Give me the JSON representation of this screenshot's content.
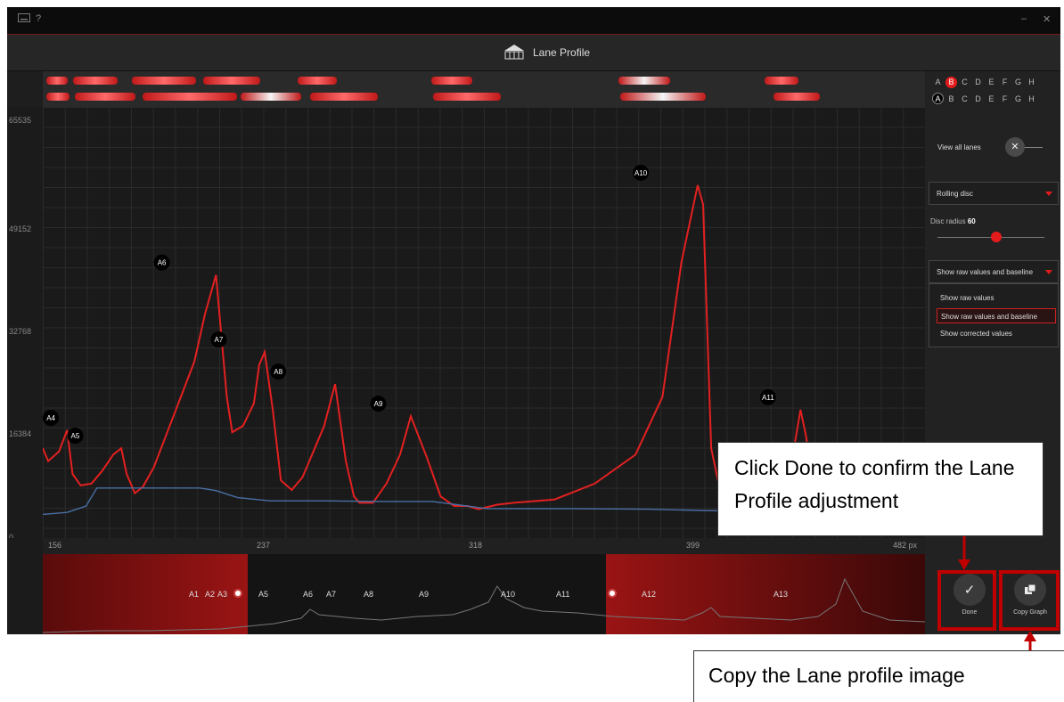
{
  "window": {
    "keyboard_icon": "keyboard-icon",
    "help_label": "?",
    "minimize_label": "–",
    "close_label": "✕"
  },
  "header": {
    "title": "Lane Profile",
    "icon": "gel-box-icon"
  },
  "y_axis": {
    "ticks": [
      "65535",
      "49152",
      "32768",
      "16384",
      "0"
    ]
  },
  "x_axis": {
    "ticks": [
      "156",
      "237",
      "318",
      "399",
      "482 px"
    ]
  },
  "lanes": {
    "top_row": [
      "A",
      "B",
      "C",
      "D",
      "E",
      "F",
      "G",
      "H"
    ],
    "bottom_row": [
      "A",
      "B",
      "C",
      "D",
      "E",
      "F",
      "G",
      "H"
    ],
    "top_selected": "B",
    "bottom_selected": "A"
  },
  "sidebar": {
    "view_all_label": "View all lanes",
    "method_value": "Rolling disc",
    "disc_radius_label": "Disc radius",
    "disc_radius_value": "60",
    "disc_radius_level": 0.55,
    "display_value": "Show raw values and baseline",
    "display_options": [
      "Show raw values",
      "Show raw values and baseline",
      "Show corrected values"
    ],
    "selected_option_index": 1,
    "done_label": "Done",
    "copy_label": "Copy Graph"
  },
  "peaks": [
    "A4",
    "A5",
    "A6",
    "A7",
    "A8",
    "A9",
    "A10",
    "A11"
  ],
  "overview_labels": [
    "A1",
    "A2",
    "A3",
    "A5",
    "A6",
    "A7",
    "A8",
    "A9",
    "A10",
    "A11",
    "A12",
    "A13"
  ],
  "callouts": {
    "done": "Click Done to confirm the Lane Profile adjustment",
    "copy": "Copy the Lane profile image"
  },
  "colors": {
    "accent": "#e31b1b",
    "profile": "#e32020",
    "baseline": "#4a6fa5",
    "background": "#1e1e1e"
  },
  "chart_data": {
    "type": "line",
    "xlabel": "",
    "ylabel": "",
    "xlim": [
      156,
      482
    ],
    "ylim": [
      0,
      65535
    ],
    "x_ticks": [
      156,
      237,
      318,
      399,
      482
    ],
    "y_ticks": [
      0,
      16384,
      32768,
      49152,
      65535
    ],
    "series": [
      {
        "role": "raw",
        "x": [
          156,
          158,
          162,
          165,
          167,
          170,
          174,
          178,
          182,
          185,
          187,
          190,
          193,
          197,
          202,
          207,
          212,
          216,
          220,
          224,
          226,
          230,
          234,
          236,
          238,
          241,
          244,
          248,
          252,
          256,
          260,
          264,
          268,
          271,
          273,
          275,
          278,
          283,
          288,
          292,
          298,
          303,
          308,
          313,
          317,
          320,
          324,
          330,
          345,
          360,
          375,
          385,
          392,
          398,
          400,
          403,
          406,
          410,
          416,
          420,
          428,
          432,
          434,
          436,
          438,
          440,
          444,
          448,
          455,
          482
        ],
        "values": [
          14000,
          12000,
          13500,
          16800,
          10000,
          8200,
          8500,
          10500,
          13000,
          14000,
          10000,
          7000,
          8000,
          11000,
          16500,
          22000,
          27500,
          35000,
          41000,
          22000,
          16500,
          17500,
          21000,
          27000,
          29000,
          20000,
          9000,
          7500,
          9500,
          13500,
          17500,
          24000,
          12000,
          6500,
          5500,
          5500,
          5500,
          8500,
          13000,
          19000,
          12500,
          6500,
          5000,
          5000,
          4500,
          4800,
          5200,
          5500,
          6000,
          8500,
          13000,
          22000,
          43000,
          55000,
          52000,
          14000,
          8000,
          6500,
          5500,
          5200,
          5200,
          8000,
          15000,
          20000,
          16000,
          10000,
          7000,
          5500,
          5000,
          4800
        ]
      },
      {
        "role": "baseline",
        "x": [
          156,
          165,
          172,
          176,
          184,
          190,
          197,
          205,
          214,
          220,
          228,
          240,
          260,
          280,
          300,
          320,
          350,
          380,
          400,
          420,
          440,
          460,
          482
        ],
        "values": [
          3700,
          4000,
          5000,
          7800,
          7800,
          7800,
          7800,
          7800,
          7800,
          7400,
          6300,
          5800,
          5800,
          5700,
          5700,
          4600,
          4600,
          4500,
          4300,
          4200,
          4000,
          3900,
          3800
        ]
      }
    ],
    "peak_labels": [
      {
        "label": "A4",
        "x": 159,
        "y": 16800
      },
      {
        "label": "A5",
        "x": 168,
        "y": 14000
      },
      {
        "label": "A6",
        "x": 200,
        "y": 41000
      },
      {
        "label": "A7",
        "x": 221,
        "y": 29000
      },
      {
        "label": "A8",
        "x": 243,
        "y": 24000
      },
      {
        "label": "A9",
        "x": 280,
        "y": 19000
      },
      {
        "label": "A10",
        "x": 377,
        "y": 55000
      },
      {
        "label": "A11",
        "x": 424,
        "y": 20000
      }
    ]
  }
}
